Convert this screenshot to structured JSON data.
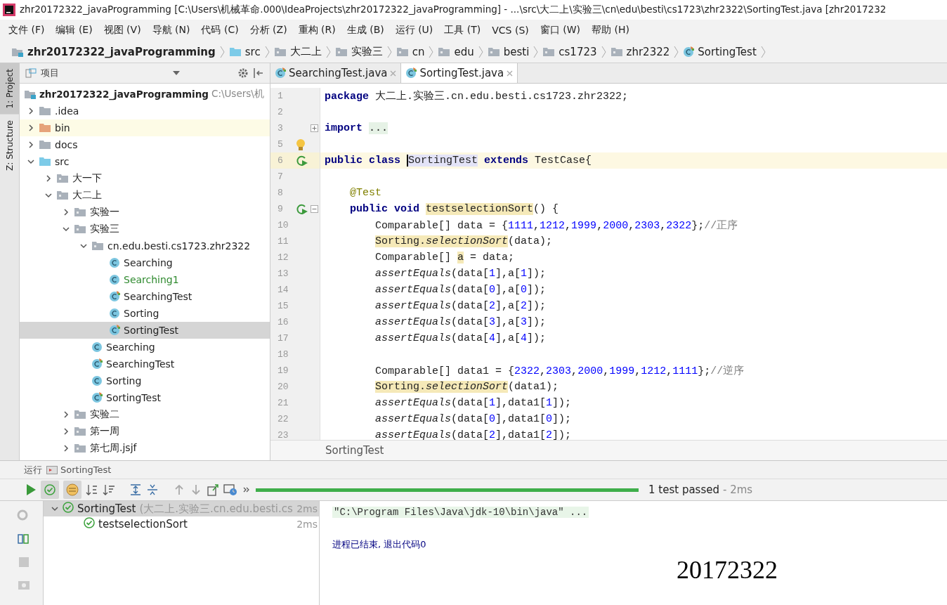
{
  "window": {
    "title": "zhr20172322_javaProgramming [C:\\Users\\机械革命.000\\IdeaProjects\\zhr20172322_javaProgramming] - ...\\src\\大二上\\实验三\\cn\\edu\\besti\\cs1723\\zhr2322\\SortingTest.java [zhr2017232"
  },
  "menu": [
    "文件 (F)",
    "编辑 (E)",
    "视图 (V)",
    "导航 (N)",
    "代码 (C)",
    "分析 (Z)",
    "重构 (R)",
    "生成 (B)",
    "运行 (U)",
    "工具 (T)",
    "VCS (S)",
    "窗口 (W)",
    "帮助 (H)"
  ],
  "breadcrumb": [
    {
      "label": "zhr20172322_javaProgramming",
      "kind": "module"
    },
    {
      "label": "src",
      "kind": "source"
    },
    {
      "label": "大二上",
      "kind": "package"
    },
    {
      "label": "实验三",
      "kind": "package"
    },
    {
      "label": "cn",
      "kind": "package"
    },
    {
      "label": "edu",
      "kind": "package"
    },
    {
      "label": "besti",
      "kind": "package"
    },
    {
      "label": "cs1723",
      "kind": "package"
    },
    {
      "label": "zhr2322",
      "kind": "package"
    },
    {
      "label": "SortingTest",
      "kind": "test-class"
    }
  ],
  "tool_strip": [
    {
      "label": "1: Project",
      "selected": true
    },
    {
      "label": "Z: Structure",
      "selected": false
    }
  ],
  "project_panel": {
    "title": "项目",
    "tree": {
      "label": "zhr20172322_javaProgramming",
      "path": "C:\\Users\\机",
      "kind": "module",
      "selected": false,
      "children": [
        {
          "label": ".idea",
          "kind": "folder",
          "expanded": false,
          "selected": false,
          "added": false
        },
        {
          "label": "bin",
          "kind": "excluded",
          "expanded": false,
          "selected": false,
          "added": false
        },
        {
          "label": "docs",
          "kind": "folder",
          "expanded": false,
          "selected": false,
          "added": false
        },
        {
          "label": "src",
          "kind": "source",
          "expanded": true,
          "selected": false,
          "added": false,
          "children": [
            {
              "label": "大一下",
              "kind": "package",
              "expanded": false,
              "selected": false,
              "added": false
            },
            {
              "label": "大二上",
              "kind": "package",
              "expanded": true,
              "selected": false,
              "added": false,
              "children": [
                {
                  "label": "实验一",
                  "kind": "package",
                  "expanded": false,
                  "selected": false,
                  "added": false
                },
                {
                  "label": "实验三",
                  "kind": "package",
                  "expanded": true,
                  "selected": false,
                  "added": false,
                  "children": [
                    {
                      "label": "cn.edu.besti.cs1723.zhr2322",
                      "kind": "package",
                      "expanded": true,
                      "selected": false,
                      "added": false,
                      "children": [
                        {
                          "label": "Searching",
                          "kind": "class",
                          "selected": false,
                          "added": false
                        },
                        {
                          "label": "Searching1",
                          "kind": "class",
                          "selected": false,
                          "added": true
                        },
                        {
                          "label": "SearchingTest",
                          "kind": "test-class",
                          "selected": false,
                          "added": false
                        },
                        {
                          "label": "Sorting",
                          "kind": "class",
                          "selected": false,
                          "added": false
                        },
                        {
                          "label": "SortingTest",
                          "kind": "test-class",
                          "selected": true,
                          "added": false
                        }
                      ]
                    },
                    {
                      "label": "Searching",
                      "kind": "class",
                      "selected": false,
                      "added": false
                    },
                    {
                      "label": "SearchingTest",
                      "kind": "test-class",
                      "selected": false,
                      "added": false
                    },
                    {
                      "label": "Sorting",
                      "kind": "class",
                      "selected": false,
                      "added": false
                    },
                    {
                      "label": "SortingTest",
                      "kind": "test-class",
                      "selected": false,
                      "added": false
                    }
                  ]
                },
                {
                  "label": "实验二",
                  "kind": "package",
                  "expanded": false,
                  "selected": false,
                  "added": false
                },
                {
                  "label": "第一周",
                  "kind": "package",
                  "expanded": false,
                  "selected": false,
                  "added": false
                },
                {
                  "label": "第七周.jsjf",
                  "kind": "package",
                  "expanded": false,
                  "selected": false,
                  "added": false
                }
              ]
            }
          ]
        }
      ]
    }
  },
  "editor": {
    "tabs": [
      {
        "label": "SearchingTest.java",
        "selected": false
      },
      {
        "label": "SortingTest.java",
        "selected": true
      }
    ],
    "lines": [
      {
        "number": "1",
        "current": false,
        "run_button": false,
        "bulb": false,
        "tokens": [
          {
            "text": "package",
            "kind": "kw"
          },
          {
            "text": " 大二上.实验三.cn.edu.besti.cs1723.zhr2322;",
            "kind": "text"
          }
        ]
      },
      {
        "number": "2",
        "current": false,
        "run_button": false,
        "bulb": false
      },
      {
        "number": "3",
        "current": false,
        "run_button": false,
        "bulb": false,
        "folded": true,
        "tokens": [
          {
            "text": "import ",
            "kind": "kw"
          },
          {
            "text": "...",
            "kind": "folded"
          }
        ]
      },
      {
        "number": "5",
        "current": false,
        "run_button": false,
        "bulb": true
      },
      {
        "number": "6",
        "current": true,
        "run_button": true,
        "bulb": false,
        "tokens": [
          {
            "text": "public class ",
            "kind": "kw"
          },
          {
            "text": "SortingTest",
            "kind": "ref"
          },
          {
            "text": " extends",
            "kind": "kw"
          },
          {
            "text": " TestCase{",
            "kind": "text"
          }
        ]
      },
      {
        "number": "7",
        "current": false,
        "run_button": false,
        "bulb": false
      },
      {
        "number": "8",
        "current": false,
        "run_button": false,
        "bulb": false,
        "tokens": [
          {
            "text": "    @Test",
            "kind": "ann"
          }
        ]
      },
      {
        "number": "9",
        "current": false,
        "run_button": true,
        "bulb": false,
        "folded": false,
        "tokens": [
          {
            "text": "    public void ",
            "kind": "kw"
          },
          {
            "text": "testselectionSort",
            "kind": "hl"
          },
          {
            "text": "() {",
            "kind": "text"
          }
        ]
      },
      {
        "number": "10",
        "current": false,
        "run_button": false,
        "bulb": false,
        "tokens": [
          {
            "text": "        Comparable[] data = {",
            "kind": "text"
          },
          {
            "text": "1111",
            "kind": "num"
          },
          {
            "text": ",",
            "kind": "text"
          },
          {
            "text": "1212",
            "kind": "num"
          },
          {
            "text": ",",
            "kind": "text"
          },
          {
            "text": "1999",
            "kind": "num"
          },
          {
            "text": ",",
            "kind": "text"
          },
          {
            "text": "2000",
            "kind": "num"
          },
          {
            "text": ",",
            "kind": "text"
          },
          {
            "text": "2303",
            "kind": "num"
          },
          {
            "text": ",",
            "kind": "text"
          },
          {
            "text": "2322",
            "kind": "num"
          },
          {
            "text": "};",
            "kind": "text"
          },
          {
            "text": "//正序",
            "kind": "comment"
          }
        ]
      },
      {
        "number": "11",
        "current": false,
        "run_button": false,
        "bulb": false,
        "tokens": [
          {
            "text": "        Sorting.",
            "kind": "hl"
          },
          {
            "text": "selectionSort",
            "kind": "hl-italic"
          },
          {
            "text": "(data);",
            "kind": "text"
          }
        ]
      },
      {
        "number": "12",
        "current": false,
        "run_button": false,
        "bulb": false,
        "tokens": [
          {
            "text": "        Comparable[] ",
            "kind": "text"
          },
          {
            "text": "a",
            "kind": "hl"
          },
          {
            "text": " = data;",
            "kind": "text"
          }
        ]
      },
      {
        "number": "13",
        "current": false,
        "run_button": false,
        "bulb": false,
        "tokens": [
          {
            "text": "        assertEquals",
            "kind": "italic"
          },
          {
            "text": "(data[",
            "kind": "text"
          },
          {
            "text": "1",
            "kind": "num"
          },
          {
            "text": "],a[",
            "kind": "text"
          },
          {
            "text": "1",
            "kind": "num"
          },
          {
            "text": "]);",
            "kind": "text"
          }
        ]
      },
      {
        "number": "14",
        "current": false,
        "run_button": false,
        "bulb": false,
        "tokens": [
          {
            "text": "        assertEquals",
            "kind": "italic"
          },
          {
            "text": "(data[",
            "kind": "text"
          },
          {
            "text": "0",
            "kind": "num"
          },
          {
            "text": "],a[",
            "kind": "text"
          },
          {
            "text": "0",
            "kind": "num"
          },
          {
            "text": "]);",
            "kind": "text"
          }
        ]
      },
      {
        "number": "15",
        "current": false,
        "run_button": false,
        "bulb": false,
        "tokens": [
          {
            "text": "        assertEquals",
            "kind": "italic"
          },
          {
            "text": "(data[",
            "kind": "text"
          },
          {
            "text": "2",
            "kind": "num"
          },
          {
            "text": "],a[",
            "kind": "text"
          },
          {
            "text": "2",
            "kind": "num"
          },
          {
            "text": "]);",
            "kind": "text"
          }
        ]
      },
      {
        "number": "16",
        "current": false,
        "run_button": false,
        "bulb": false,
        "tokens": [
          {
            "text": "        assertEquals",
            "kind": "italic"
          },
          {
            "text": "(data[",
            "kind": "text"
          },
          {
            "text": "3",
            "kind": "num"
          },
          {
            "text": "],a[",
            "kind": "text"
          },
          {
            "text": "3",
            "kind": "num"
          },
          {
            "text": "]);",
            "kind": "text"
          }
        ]
      },
      {
        "number": "17",
        "current": false,
        "run_button": false,
        "bulb": false,
        "tokens": [
          {
            "text": "        assertEquals",
            "kind": "italic"
          },
          {
            "text": "(data[",
            "kind": "text"
          },
          {
            "text": "4",
            "kind": "num"
          },
          {
            "text": "],a[",
            "kind": "text"
          },
          {
            "text": "4",
            "kind": "num"
          },
          {
            "text": "]);",
            "kind": "text"
          }
        ]
      },
      {
        "number": "18",
        "current": false,
        "run_button": false,
        "bulb": false
      },
      {
        "number": "19",
        "current": false,
        "run_button": false,
        "bulb": false,
        "tokens": [
          {
            "text": "        Comparable[] data1 = {",
            "kind": "text"
          },
          {
            "text": "2322",
            "kind": "num"
          },
          {
            "text": ",",
            "kind": "text"
          },
          {
            "text": "2303",
            "kind": "num"
          },
          {
            "text": ",",
            "kind": "text"
          },
          {
            "text": "2000",
            "kind": "num"
          },
          {
            "text": ",",
            "kind": "text"
          },
          {
            "text": "1999",
            "kind": "num"
          },
          {
            "text": ",",
            "kind": "text"
          },
          {
            "text": "1212",
            "kind": "num"
          },
          {
            "text": ",",
            "kind": "text"
          },
          {
            "text": "1111",
            "kind": "num"
          },
          {
            "text": "};",
            "kind": "text"
          },
          {
            "text": "//逆序",
            "kind": "comment"
          }
        ]
      },
      {
        "number": "20",
        "current": false,
        "run_button": false,
        "bulb": false,
        "tokens": [
          {
            "text": "        Sorting.",
            "kind": "hl"
          },
          {
            "text": "selectionSort",
            "kind": "hl-italic"
          },
          {
            "text": "(data1);",
            "kind": "text"
          }
        ]
      },
      {
        "number": "21",
        "current": false,
        "run_button": false,
        "bulb": false,
        "tokens": [
          {
            "text": "        assertEquals",
            "kind": "italic"
          },
          {
            "text": "(data[",
            "kind": "text"
          },
          {
            "text": "1",
            "kind": "num"
          },
          {
            "text": "],data1[",
            "kind": "text"
          },
          {
            "text": "1",
            "kind": "num"
          },
          {
            "text": "]);",
            "kind": "text"
          }
        ]
      },
      {
        "number": "22",
        "current": false,
        "run_button": false,
        "bulb": false,
        "tokens": [
          {
            "text": "        assertEquals",
            "kind": "italic"
          },
          {
            "text": "(data[",
            "kind": "text"
          },
          {
            "text": "0",
            "kind": "num"
          },
          {
            "text": "],data1[",
            "kind": "text"
          },
          {
            "text": "0",
            "kind": "num"
          },
          {
            "text": "]);",
            "kind": "text"
          }
        ]
      },
      {
        "number": "23",
        "current": false,
        "run_button": false,
        "bulb": false,
        "tokens": [
          {
            "text": "        assertEquals",
            "kind": "italic"
          },
          {
            "text": "(data[",
            "kind": "text"
          },
          {
            "text": "2",
            "kind": "num"
          },
          {
            "text": "],data1[",
            "kind": "text"
          },
          {
            "text": "2",
            "kind": "num"
          },
          {
            "text": "]);",
            "kind": "text"
          }
        ]
      }
    ],
    "breadcrumb": "SortingTest"
  },
  "run": {
    "title": "运行",
    "tab": "SortingTest",
    "level": 1,
    "status": "1 test passed",
    "duration": "- 2ms",
    "tree": [
      {
        "label": "SortingTest",
        "detail": "(大二上.实验三.cn.edu.besti.cs",
        "time": "2ms",
        "passed": true,
        "expanded": true,
        "selected": true,
        "children": [
          {
            "label": "testselectionSort",
            "time": "2ms",
            "passed": true,
            "selected": false
          }
        ]
      }
    ],
    "console": [
      {
        "text": "\"C:\\Program Files\\Java\\jdk-10\\bin\\java\" ...",
        "kind": "command"
      },
      {
        "text": "进程已结束, 退出代码0",
        "kind": "exit"
      }
    ],
    "note": "20172322"
  }
}
